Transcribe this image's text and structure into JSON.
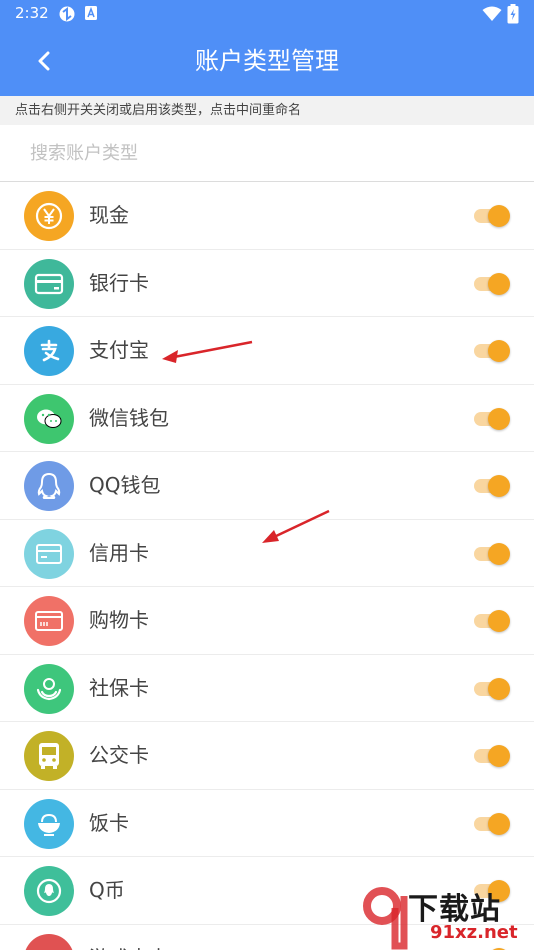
{
  "status": {
    "time": "2:32"
  },
  "header": {
    "title": "账户类型管理"
  },
  "hint": "点击右侧开关关闭或启用该类型，点击中间重命名",
  "search": {
    "placeholder": "搜索账户类型"
  },
  "accounts": [
    {
      "label": "现金",
      "color": "#f5a623",
      "icon": "yen-icon",
      "enabled": true
    },
    {
      "label": "银行卡",
      "color": "#3fb89a",
      "icon": "bank-card-icon",
      "enabled": true
    },
    {
      "label": "支付宝",
      "color": "#38a9e0",
      "icon": "alipay-icon",
      "enabled": true
    },
    {
      "label": "微信钱包",
      "color": "#3ec66f",
      "icon": "wechat-icon",
      "enabled": true
    },
    {
      "label": "QQ钱包",
      "color": "#6f9be6",
      "icon": "qq-icon",
      "enabled": true
    },
    {
      "label": "信用卡",
      "color": "#7fd3e0",
      "icon": "credit-card-icon",
      "enabled": true
    },
    {
      "label": "购物卡",
      "color": "#f07167",
      "icon": "shopping-card-icon",
      "enabled": true
    },
    {
      "label": "社保卡",
      "color": "#3ec67c",
      "icon": "social-security-icon",
      "enabled": true
    },
    {
      "label": "公交卡",
      "color": "#c2b127",
      "icon": "bus-icon",
      "enabled": true
    },
    {
      "label": "饭卡",
      "color": "#44b7e3",
      "icon": "meal-bowl-icon",
      "enabled": true
    },
    {
      "label": "Q币",
      "color": "#3fbf9a",
      "icon": "qcoin-icon",
      "enabled": true
    },
    {
      "label": "游戏点卡",
      "color": "#e05252",
      "icon": "game-card-icon",
      "enabled": true
    }
  ],
  "watermark": {
    "brand": "下载站",
    "site": "91xz.net"
  }
}
